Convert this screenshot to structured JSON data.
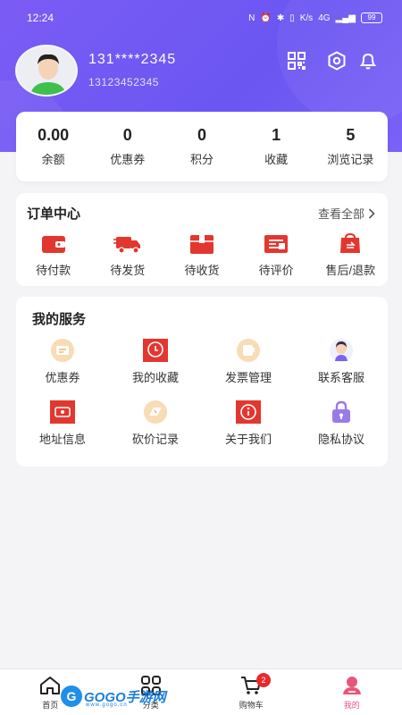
{
  "status_bar": {
    "time": "12:24",
    "network": "4G",
    "speed": "K/s",
    "battery": "99"
  },
  "profile": {
    "phone_masked": "131****2345",
    "phone_full": "13123452345"
  },
  "header_icons": [
    "qrcode-icon",
    "settings-icon",
    "bell-icon"
  ],
  "stats": [
    {
      "value": "0.00",
      "label": "余额"
    },
    {
      "value": "0",
      "label": "优惠券"
    },
    {
      "value": "0",
      "label": "积分"
    },
    {
      "value": "1",
      "label": "收藏"
    },
    {
      "value": "5",
      "label": "浏览记录"
    }
  ],
  "orders": {
    "title": "订单中心",
    "view_all": "查看全部",
    "items": [
      {
        "label": "待付款",
        "icon": "wallet-icon"
      },
      {
        "label": "待发货",
        "icon": "truck-icon"
      },
      {
        "label": "待收货",
        "icon": "box-icon"
      },
      {
        "label": "待评价",
        "icon": "review-icon"
      },
      {
        "label": "售后/退款",
        "icon": "refund-icon"
      }
    ]
  },
  "services": {
    "title": "我的服务",
    "items": [
      {
        "label": "优惠券",
        "icon": "coupon-icon"
      },
      {
        "label": "我的收藏",
        "icon": "favorite-icon"
      },
      {
        "label": "发票管理",
        "icon": "invoice-icon"
      },
      {
        "label": "联系客服",
        "icon": "customer-service-icon"
      },
      {
        "label": "地址信息",
        "icon": "address-icon"
      },
      {
        "label": "砍价记录",
        "icon": "bargain-icon"
      },
      {
        "label": "关于我们",
        "icon": "about-icon"
      },
      {
        "label": "隐私协议",
        "icon": "lock-icon"
      }
    ]
  },
  "tabbar": {
    "items": [
      {
        "label": "首页",
        "icon": "home-icon",
        "active": false
      },
      {
        "label": "分类",
        "icon": "category-icon",
        "active": false
      },
      {
        "label": "购物车",
        "icon": "cart-icon",
        "active": false
      },
      {
        "label": "我的",
        "icon": "profile-icon",
        "active": true
      }
    ],
    "cart_badge": "2"
  },
  "watermark": {
    "logo": "G",
    "text": "GOGO手游网",
    "sub": "www.gogo.cn"
  },
  "colors": {
    "header": "#6b56f2",
    "accent_red": "#e2372f",
    "active_tab": "#e8557a"
  }
}
